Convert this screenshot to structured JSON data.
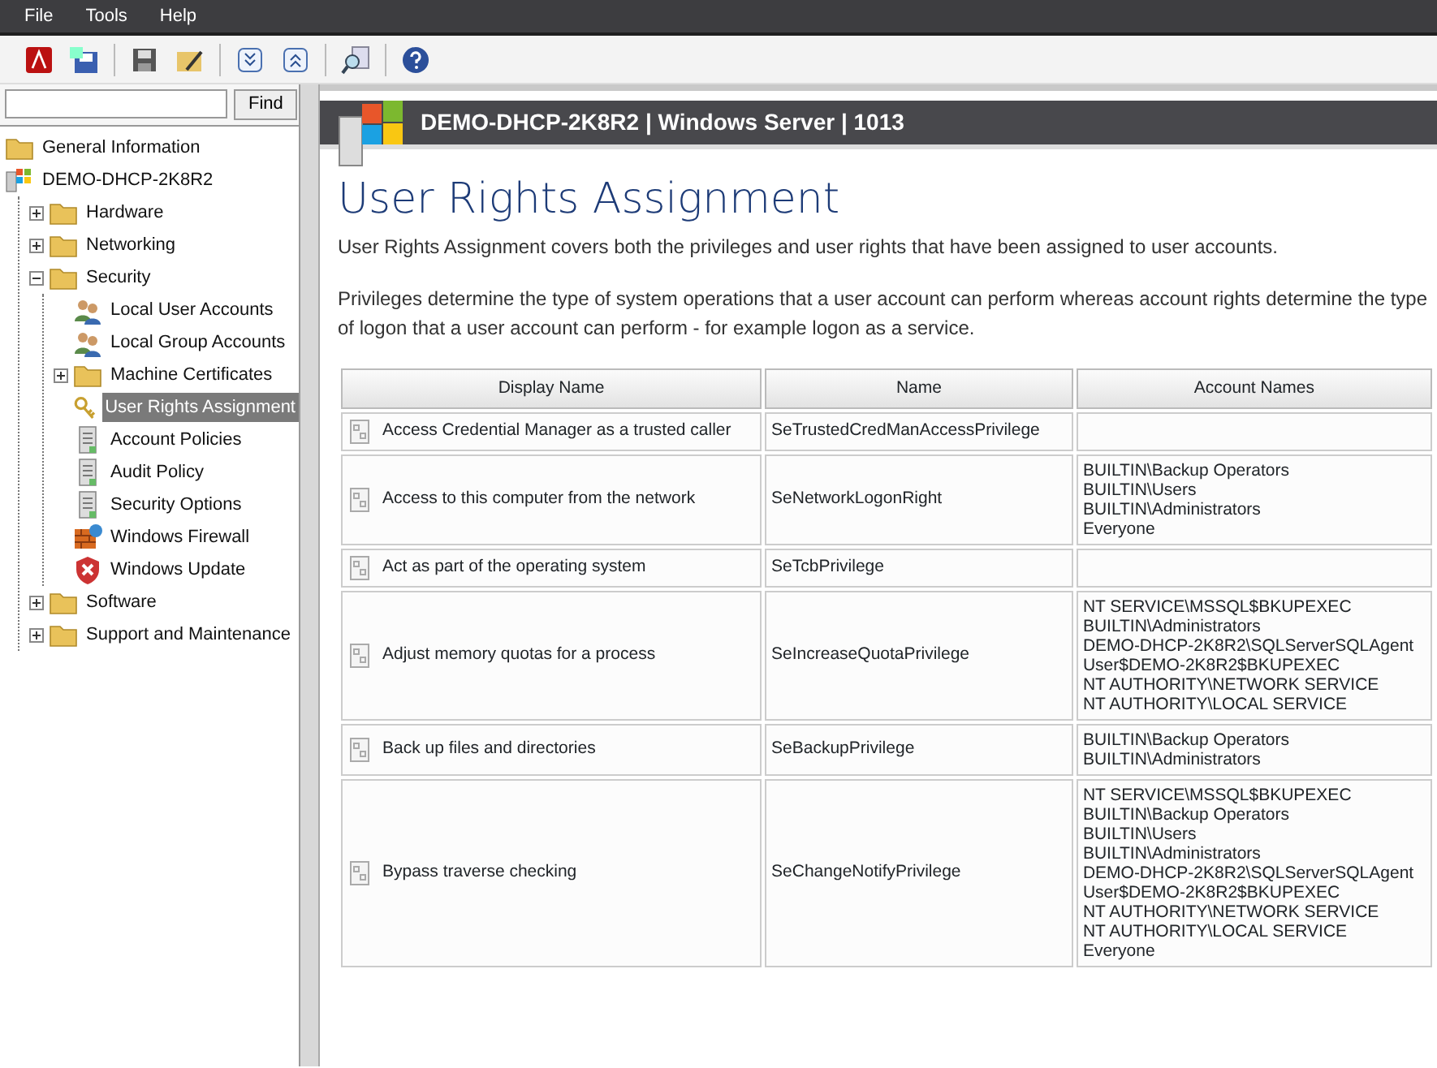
{
  "menu": [
    "File",
    "Tools",
    "Help"
  ],
  "toolbar": [
    {
      "kind": "pdf"
    },
    {
      "kind": "export"
    },
    {
      "kind": "sep"
    },
    {
      "kind": "save"
    },
    {
      "kind": "edit"
    },
    {
      "kind": "sep"
    },
    {
      "kind": "expand"
    },
    {
      "kind": "collapse"
    },
    {
      "kind": "sep"
    },
    {
      "kind": "find"
    },
    {
      "kind": "sep"
    },
    {
      "kind": "help"
    }
  ],
  "search": {
    "button": "Find"
  },
  "tree": [
    {
      "label": "General Information",
      "kind": "folder",
      "selected": false
    },
    {
      "label": "DEMO-DHCP-2K8R2",
      "kind": "server",
      "selected": false,
      "children": [
        {
          "label": "Hardware",
          "kind": "folder",
          "selected": false,
          "expanded": false
        },
        {
          "label": "Networking",
          "kind": "folder",
          "selected": false,
          "expanded": false
        },
        {
          "label": "Security",
          "kind": "folder",
          "selected": false,
          "expanded": true,
          "children": [
            {
              "label": "Local User Accounts",
              "kind": "users",
              "selected": false
            },
            {
              "label": "Local Group Accounts",
              "kind": "users",
              "selected": false
            },
            {
              "label": "Machine Certificates",
              "kind": "folder",
              "selected": false,
              "expanded": false
            },
            {
              "label": "User Rights Assignment",
              "kind": "keys",
              "selected": true
            },
            {
              "label": "Account Policies",
              "kind": "policy",
              "selected": false
            },
            {
              "label": "Audit Policy",
              "kind": "policy",
              "selected": false
            },
            {
              "label": "Security Options",
              "kind": "policy",
              "selected": false
            },
            {
              "label": "Windows Firewall",
              "kind": "firewall",
              "selected": false
            },
            {
              "label": "Windows Update",
              "kind": "shield",
              "selected": false
            }
          ]
        },
        {
          "label": "Software",
          "kind": "folder",
          "selected": false,
          "expanded": false
        },
        {
          "label": "Support and Maintenance",
          "kind": "folder",
          "selected": false,
          "expanded": false
        }
      ]
    }
  ],
  "report": {
    "header": "DEMO-DHCP-2K8R2 | Windows Server | 1013",
    "title": "User Rights Assignment",
    "paragraphs": [
      "User Rights Assignment covers both the privileges and user rights that have been assigned to user accounts.",
      "Privileges determine the type of system operations that a user account can perform whereas account rights determine the type of logon that a user account can perform - for example logon as a service."
    ],
    "table": {
      "columns": [
        "Display Name",
        "Name",
        "Account Names"
      ],
      "rows": [
        {
          "display_name": "Access Credential Manager as a trusted caller",
          "name": "SeTrustedCredManAccessPrivilege",
          "accounts": []
        },
        {
          "display_name": "Access to this computer from the network",
          "name": "SeNetworkLogonRight",
          "accounts": [
            "BUILTIN\\Backup Operators",
            "BUILTIN\\Users",
            "BUILTIN\\Administrators",
            "Everyone"
          ]
        },
        {
          "display_name": "Act as part of the operating system",
          "name": "SeTcbPrivilege",
          "accounts": []
        },
        {
          "display_name": "Adjust memory quotas for a process",
          "name": "SeIncreaseQuotaPrivilege",
          "accounts": [
            "NT SERVICE\\MSSQL$BKUPEXEC",
            "BUILTIN\\Administrators",
            "DEMO-DHCP-2K8R2\\SQLServerSQLAgentUser$DEMO-2K8R2$BKUPEXEC",
            "NT AUTHORITY\\NETWORK SERVICE",
            "NT AUTHORITY\\LOCAL SERVICE"
          ]
        },
        {
          "display_name": "Back up files and directories",
          "name": "SeBackupPrivilege",
          "accounts": [
            "BUILTIN\\Backup Operators",
            "BUILTIN\\Administrators"
          ]
        },
        {
          "display_name": "Bypass traverse checking",
          "name": "SeChangeNotifyPrivilege",
          "accounts": [
            "NT SERVICE\\MSSQL$BKUPEXEC",
            "BUILTIN\\Backup Operators",
            "BUILTIN\\Users",
            "BUILTIN\\Administrators",
            "DEMO-DHCP-2K8R2\\SQLServerSQLAgentUser$DEMO-2K8R2$BKUPEXEC",
            "NT AUTHORITY\\NETWORK SERVICE",
            "NT AUTHORITY\\LOCAL SERVICE",
            "Everyone"
          ]
        }
      ]
    }
  }
}
